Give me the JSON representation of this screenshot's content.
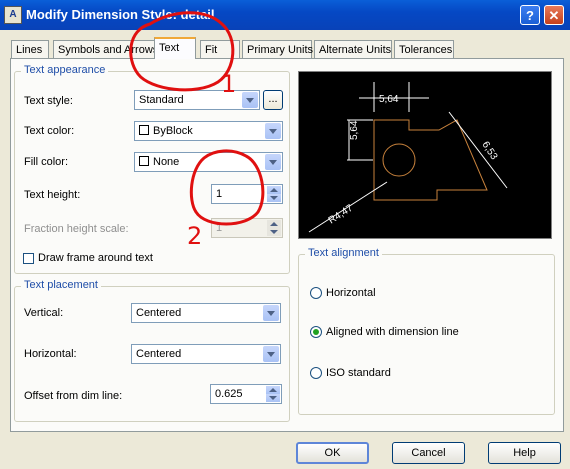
{
  "window": {
    "title": "Modify Dimension Style: detail",
    "app_icon_text": "A",
    "help_glyph": "?",
    "close_glyph": "✕"
  },
  "tabs": [
    {
      "label": "Lines",
      "active": false
    },
    {
      "label": "Symbols and Arrows",
      "active": false
    },
    {
      "label": "Text",
      "active": true
    },
    {
      "label": "Fit",
      "active": false
    },
    {
      "label": "Primary Units",
      "active": false
    },
    {
      "label": "Alternate Units",
      "active": false
    },
    {
      "label": "Tolerances",
      "active": false
    }
  ],
  "text_appearance": {
    "group_title": "Text appearance",
    "text_style_label": "Text style:",
    "text_style_value": "Standard",
    "browse_button": "...",
    "text_color_label": "Text color:",
    "text_color_value": "ByBlock",
    "fill_color_label": "Fill color:",
    "fill_color_value": "None",
    "text_height_label": "Text height:",
    "text_height_value": "1",
    "fraction_height_label": "Fraction height scale:",
    "fraction_height_value": "1",
    "draw_frame_label": "Draw frame around text",
    "draw_frame_checked": false
  },
  "text_placement": {
    "group_title": "Text placement",
    "vertical_label": "Vertical:",
    "vertical_value": "Centered",
    "horizontal_label": "Horizontal:",
    "horizontal_value": "Centered",
    "offset_label": "Offset from dim line:",
    "offset_value": "0.625"
  },
  "preview": {
    "dim_vertical": "5,64",
    "dim_horizontal": "5,64",
    "dim_aligned": "6,53",
    "dim_radius": "R4,47",
    "line_color": "#ffffff",
    "shape_color": "#c8823c"
  },
  "text_alignment": {
    "group_title": "Text alignment",
    "options": [
      {
        "label": "Horizontal",
        "checked": false
      },
      {
        "label": "Aligned with dimension line",
        "checked": true
      },
      {
        "label": "ISO standard",
        "checked": false
      }
    ]
  },
  "buttons": {
    "ok": "OK",
    "cancel": "Cancel",
    "help": "Help"
  },
  "annotations": {
    "number_1": "1",
    "number_2": "2",
    "ink_color": "#e01010"
  }
}
